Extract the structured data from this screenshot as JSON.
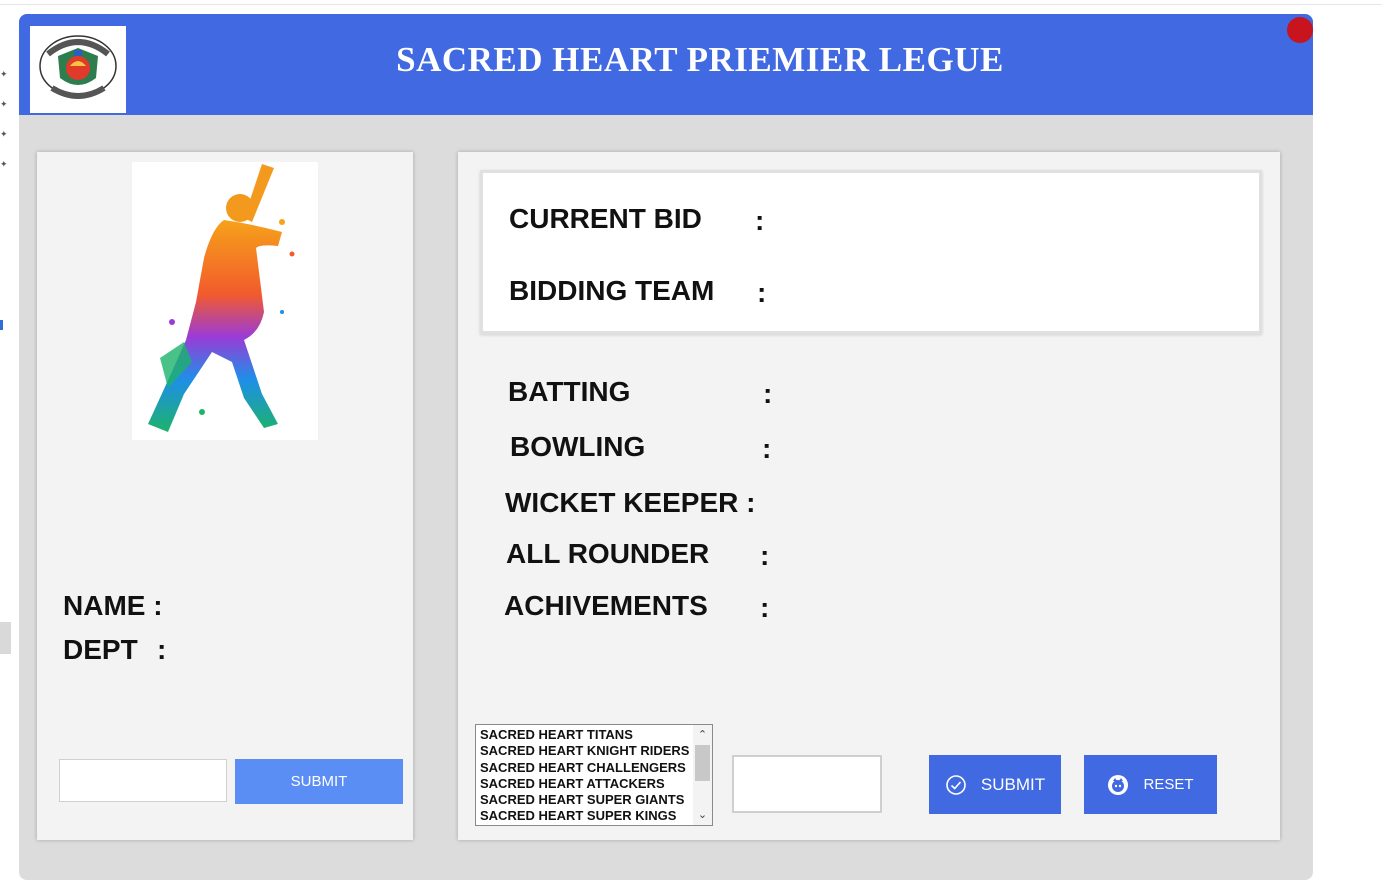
{
  "header": {
    "title": "SACRED HEART PRIEMIER LEGUE",
    "color": "#4169e1"
  },
  "player": {
    "name_label": "NAME :",
    "dept_label": "DEPT",
    "dept_colon": ":",
    "search_value": "",
    "submit_label": "SUBMIT"
  },
  "bid": {
    "current_bid_label": "CURRENT BID",
    "bidding_team_label": "BIDDING TEAM",
    "colon": ":"
  },
  "stats": {
    "batting_label": "BATTING",
    "bowling_label": "BOWLING",
    "wicket_keeper_label": "WICKET KEEPER :",
    "all_rounder_label": "ALL ROUNDER",
    "achivements_label": "ACHIVEMENTS",
    "colon": ":"
  },
  "teams": {
    "items": [
      "SACRED HEART TITANS",
      "SACRED HEART KNIGHT RIDERS",
      "SACRED HEART CHALLENGERS",
      "SACRED HEART ATTACKERS",
      "SACRED HEART SUPER GIANTS",
      "SACRED HEART SUPER KINGS"
    ]
  },
  "actions": {
    "amount_value": "",
    "submit_label": "SUBMIT",
    "reset_label": "RESET"
  },
  "icons": {
    "logo": "college-crest-icon",
    "player": "cricket-batsman-icon",
    "submit": "check-circle-icon",
    "reset": "reset-icon",
    "close": "close-dot-icon"
  }
}
